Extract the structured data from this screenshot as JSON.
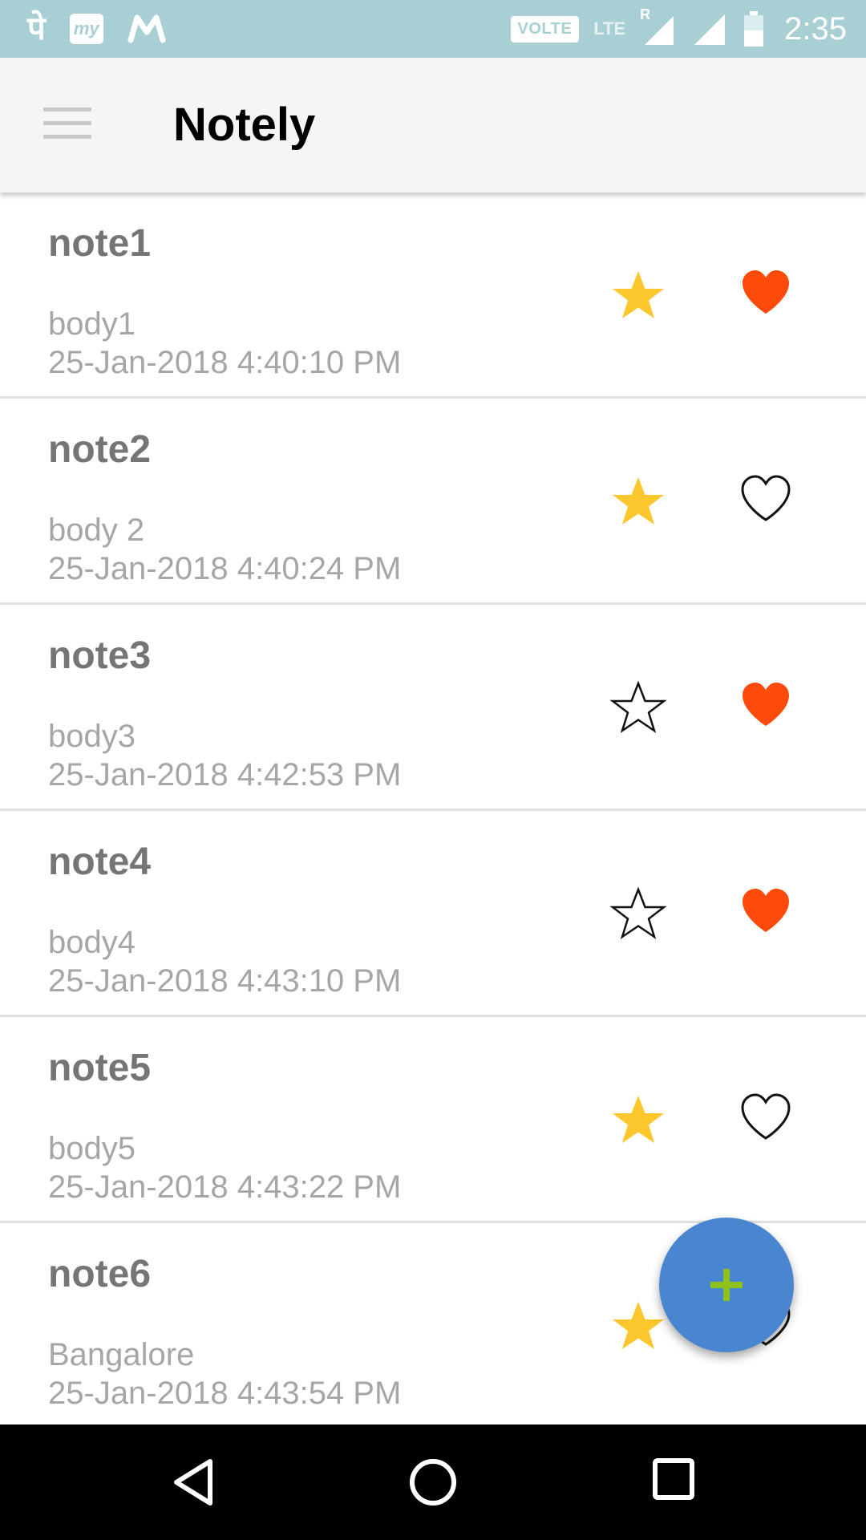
{
  "status_bar": {
    "icons": [
      "phonepe-icon",
      "myjio-icon",
      "gmail-icon"
    ],
    "my_label": "my",
    "volte": "VOLTE",
    "lte": "LTE",
    "roaming": "R",
    "time": "2:35"
  },
  "app_bar": {
    "menu_icon": "hamburger-menu-icon",
    "title": "Notely"
  },
  "colors": {
    "status_bar": "#a8cfd3",
    "app_bar": "#f5f5f5",
    "star_filled": "#fcc72c",
    "heart_filled": "#fe4a0a",
    "fab": "#4a86cf",
    "fab_plus": "#8dc21f"
  },
  "notes": [
    {
      "title": "note1",
      "body": "body1",
      "date": "25-Jan-2018 4:40:10 PM",
      "starred": true,
      "favorite": true
    },
    {
      "title": "note2",
      "body": "body 2",
      "date": "25-Jan-2018 4:40:24 PM",
      "starred": true,
      "favorite": false
    },
    {
      "title": "note3",
      "body": "body3",
      "date": "25-Jan-2018 4:42:53 PM",
      "starred": false,
      "favorite": true
    },
    {
      "title": "note4",
      "body": "body4",
      "date": "25-Jan-2018 4:43:10 PM",
      "starred": false,
      "favorite": true
    },
    {
      "title": "note5",
      "body": "body5",
      "date": "25-Jan-2018 4:43:22 PM",
      "starred": true,
      "favorite": false
    },
    {
      "title": "note6",
      "body": "Bangalore",
      "date": "25-Jan-2018 4:43:54 PM",
      "starred": true,
      "favorite": false
    }
  ],
  "fab": {
    "icon": "plus-icon"
  },
  "nav_bar": {
    "icons": [
      "back-icon",
      "home-icon",
      "recents-icon"
    ]
  }
}
